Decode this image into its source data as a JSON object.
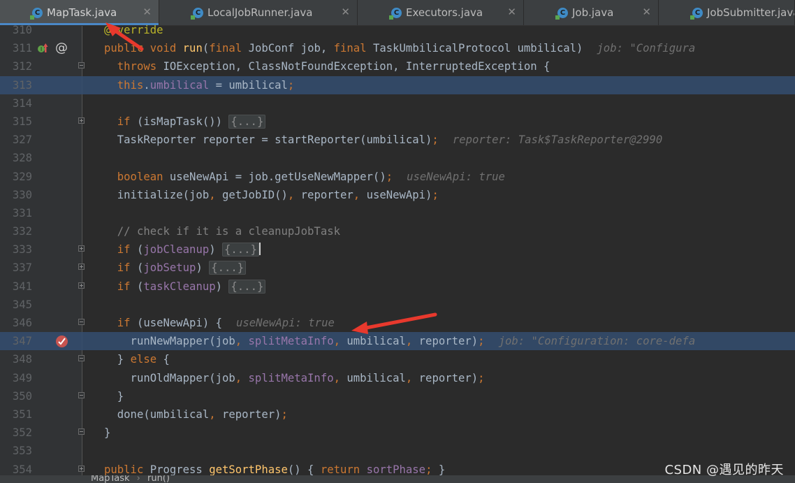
{
  "tabs": [
    {
      "label": "MapTask.java",
      "active": true
    },
    {
      "label": "LocalJobRunner.java",
      "active": false
    },
    {
      "label": "Executors.java",
      "active": false
    },
    {
      "label": "Job.java",
      "active": false
    },
    {
      "label": "JobSubmitter.java",
      "active": false
    }
  ],
  "tab_icon_letter": "C",
  "tab_close_glyph": "✕",
  "code_lines": [
    {
      "n": "310",
      "tokens": [
        [
          "ann",
          "@Override"
        ]
      ]
    },
    {
      "n": "311",
      "tokens": [
        [
          "kw",
          "public void "
        ],
        [
          "fn",
          "run"
        ],
        [
          "plain",
          "("
        ],
        [
          "kw",
          "final "
        ],
        [
          "plain",
          "JobConf job, "
        ],
        [
          "kw",
          "final "
        ],
        [
          "plain",
          "TaskUmbilicalProtocol umbilical)"
        ]
      ],
      "inline": "job: \"Configura"
    },
    {
      "n": "312",
      "tokens": [
        [
          "plain",
          "  "
        ],
        [
          "kw",
          "throws "
        ],
        [
          "plain",
          "IOException, ClassNotFoundException, InterruptedException {"
        ]
      ]
    },
    {
      "n": "313",
      "tokens": [
        [
          "plain",
          "  "
        ],
        [
          "kw",
          "this"
        ],
        [
          "plain",
          "."
        ],
        [
          "fld",
          "umbilical"
        ],
        [
          "plain",
          " = umbilical"
        ],
        [
          "kw",
          ";"
        ]
      ]
    },
    {
      "n": "314",
      "tokens": []
    },
    {
      "n": "315",
      "tokens": [
        [
          "plain",
          "  "
        ],
        [
          "kw",
          "if "
        ],
        [
          "plain",
          "(isMapTask()) "
        ]
      ],
      "collapsed": "{...}"
    },
    {
      "n": "327",
      "tokens": [
        [
          "plain",
          "  TaskReporter reporter = startReporter(umbilical)"
        ],
        [
          "kw",
          ";"
        ]
      ],
      "inline": "reporter: Task$TaskReporter@2990"
    },
    {
      "n": "328",
      "tokens": []
    },
    {
      "n": "329",
      "tokens": [
        [
          "plain",
          "  "
        ],
        [
          "kw",
          "boolean "
        ],
        [
          "plain",
          "useNewApi = job.getUseNewMapper()"
        ],
        [
          "kw",
          ";"
        ]
      ],
      "inline": "useNewApi: true"
    },
    {
      "n": "330",
      "tokens": [
        [
          "plain",
          "  initialize(job"
        ],
        [
          "kw",
          ", "
        ],
        [
          "plain",
          "getJobID()"
        ],
        [
          "kw",
          ", "
        ],
        [
          "plain",
          "reporter"
        ],
        [
          "kw",
          ", "
        ],
        [
          "plain",
          "useNewApi)"
        ],
        [
          "kw",
          ";"
        ]
      ]
    },
    {
      "n": "331",
      "tokens": []
    },
    {
      "n": "332",
      "tokens": [
        [
          "plain",
          "  "
        ],
        [
          "cm",
          "// check if it is a cleanupJobTask"
        ]
      ]
    },
    {
      "n": "333",
      "tokens": [
        [
          "plain",
          "  "
        ],
        [
          "kw",
          "if "
        ],
        [
          "plain",
          "("
        ],
        [
          "fld",
          "jobCleanup"
        ],
        [
          "plain",
          ") "
        ]
      ],
      "collapsed": "{...}",
      "caret": true
    },
    {
      "n": "337",
      "tokens": [
        [
          "plain",
          "  "
        ],
        [
          "kw",
          "if "
        ],
        [
          "plain",
          "("
        ],
        [
          "fld",
          "jobSetup"
        ],
        [
          "plain",
          ") "
        ]
      ],
      "collapsed": "{...}"
    },
    {
      "n": "341",
      "tokens": [
        [
          "plain",
          "  "
        ],
        [
          "kw",
          "if "
        ],
        [
          "plain",
          "("
        ],
        [
          "fld",
          "taskCleanup"
        ],
        [
          "plain",
          ") "
        ]
      ],
      "collapsed": "{...}"
    },
    {
      "n": "345",
      "tokens": []
    },
    {
      "n": "346",
      "tokens": [
        [
          "plain",
          "  "
        ],
        [
          "kw",
          "if "
        ],
        [
          "plain",
          "(useNewApi) {"
        ]
      ],
      "inline": "useNewApi: true"
    },
    {
      "n": "347",
      "tokens": [
        [
          "plain",
          "    runNewMapper(job"
        ],
        [
          "kw",
          ", "
        ],
        [
          "fld",
          "splitMetaInfo"
        ],
        [
          "kw",
          ", "
        ],
        [
          "plain",
          "umbilical"
        ],
        [
          "kw",
          ", "
        ],
        [
          "plain",
          "reporter)"
        ],
        [
          "kw",
          ";"
        ]
      ],
      "inline": "job: \"Configuration: core-defa"
    },
    {
      "n": "348",
      "tokens": [
        [
          "plain",
          "  } "
        ],
        [
          "kw",
          "else "
        ],
        [
          "plain",
          "{"
        ]
      ]
    },
    {
      "n": "349",
      "tokens": [
        [
          "plain",
          "    runOldMapper(job"
        ],
        [
          "kw",
          ", "
        ],
        [
          "fld",
          "splitMetaInfo"
        ],
        [
          "kw",
          ", "
        ],
        [
          "plain",
          "umbilical"
        ],
        [
          "kw",
          ", "
        ],
        [
          "plain",
          "reporter)"
        ],
        [
          "kw",
          ";"
        ]
      ]
    },
    {
      "n": "350",
      "tokens": [
        [
          "plain",
          "  }"
        ]
      ]
    },
    {
      "n": "351",
      "tokens": [
        [
          "plain",
          "  done(umbilical"
        ],
        [
          "kw",
          ", "
        ],
        [
          "plain",
          "reporter)"
        ],
        [
          "kw",
          ";"
        ]
      ]
    },
    {
      "n": "352",
      "tokens": [
        [
          "plain",
          "}"
        ]
      ]
    },
    {
      "n": "353",
      "tokens": []
    },
    {
      "n": "354",
      "tokens": [
        [
          "kw",
          "public "
        ],
        [
          "plain",
          "Progress "
        ],
        [
          "fn",
          "getSortPhase"
        ],
        [
          "plain",
          "() { "
        ],
        [
          "kw",
          "return "
        ],
        [
          "fld",
          "sortPhase"
        ],
        [
          "kw",
          "; "
        ],
        [
          "plain",
          "}"
        ]
      ]
    }
  ],
  "highlighted_lines": [
    "313",
    "347"
  ],
  "fold_markers": {
    "312": "minus",
    "315": "plus",
    "333": "plus",
    "337": "plus",
    "341": "plus",
    "346": "minus",
    "348": "minus",
    "350": "minus",
    "352": "minus",
    "354": "plus"
  },
  "gutter_icons": {
    "311": [
      "implements-up-icon",
      "at-icon"
    ],
    "347": [
      "breakpoint-icon"
    ]
  },
  "at_glyph": "@",
  "breadcrumb": [
    "MapTask",
    "run()"
  ],
  "breadcrumb_separator": "›",
  "watermark": "CSDN @遇见的昨天",
  "colors": {
    "background": "#2b2b2b",
    "gutter": "#313335",
    "keyword": "#cc7832",
    "method": "#ffc66d",
    "field": "#9876aa",
    "annotation": "#bbb529",
    "comment": "#808080",
    "text": "#a9b7c6",
    "highlight": "#344e70",
    "breakpoint": "#c75450",
    "arrow": "#e8392d"
  }
}
